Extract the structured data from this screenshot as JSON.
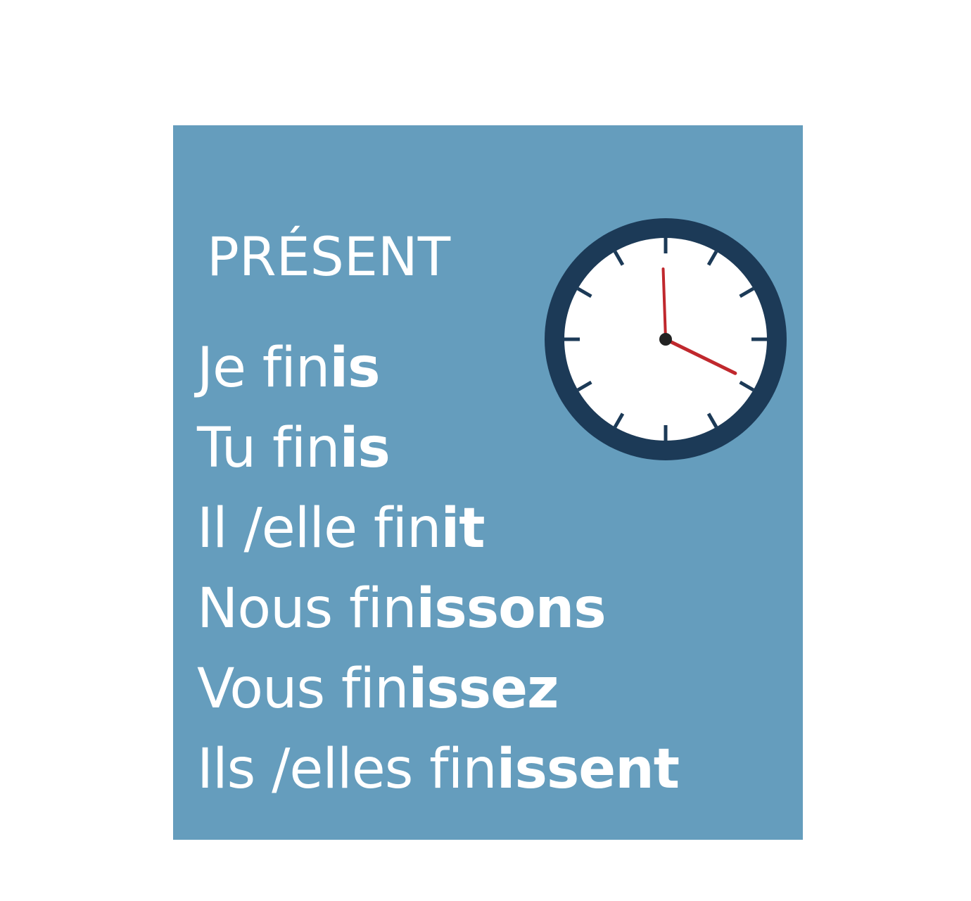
{
  "card": {
    "title": "PRÉSENT",
    "background_color": "#659dbd",
    "text_color": "#ffffff"
  },
  "clock": {
    "icon": "clock-icon",
    "rim_color": "#1c3a57",
    "face_color": "#ffffff",
    "hand_color": "#c0282d",
    "hour": 4,
    "minute": 0
  },
  "conjugations": [
    {
      "subject": "Je",
      "stem": "fin",
      "ending": "is"
    },
    {
      "subject": "Tu",
      "stem": "fin",
      "ending": "is"
    },
    {
      "subject": "Il /elle",
      "stem": "fin",
      "ending": "it"
    },
    {
      "subject": "Nous",
      "stem": "fin",
      "ending": "issons"
    },
    {
      "subject": "Vous",
      "stem": "fin",
      "ending": "issez"
    },
    {
      "subject": "Ils /elles",
      "stem": "fin",
      "ending": "issent"
    }
  ]
}
